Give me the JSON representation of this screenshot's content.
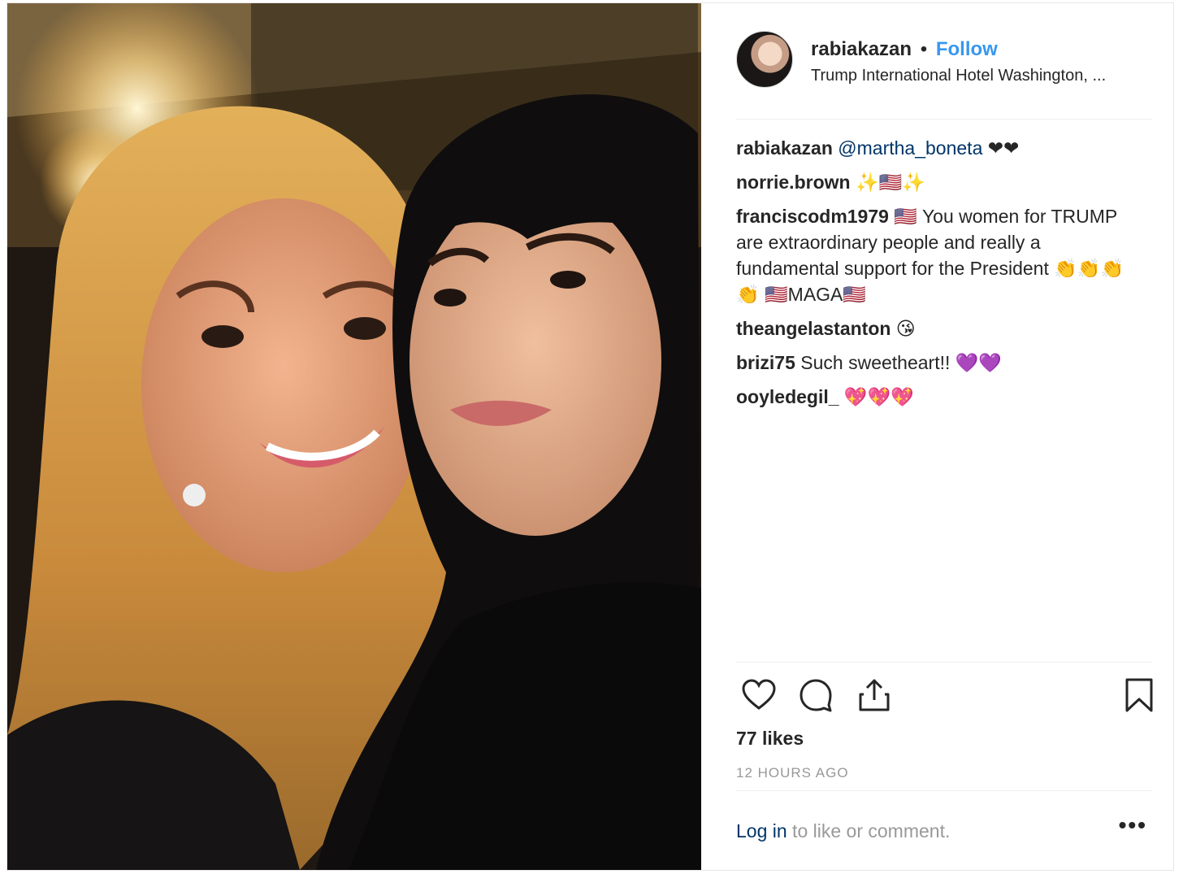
{
  "header": {
    "username": "rabiakazan",
    "separator": "•",
    "follow_label": "Follow",
    "location": "Trump International Hotel Washington, ..."
  },
  "comments": [
    {
      "user": "rabiakazan",
      "mention": "@martha_boneta",
      "text": " ❤❤"
    },
    {
      "user": "norrie.brown",
      "mention": "",
      "text": " ✨🇺🇸✨"
    },
    {
      "user": "franciscodm1979",
      "mention": "",
      "text": " 🇺🇸 You women for TRUMP are extraordinary people and really a fundamental support for the President 👏👏👏👏 🇺🇸MAGA🇺🇸"
    },
    {
      "user": "theangelastanton",
      "mention": "",
      "text": " 😘"
    },
    {
      "user": "brizi75",
      "mention": "",
      "text": " Such sweetheart!! 💜💜"
    },
    {
      "user": "ooyledegil_",
      "mention": "",
      "text": " 💖💖💖"
    }
  ],
  "actions": {
    "like_icon": "heart-icon",
    "comment_icon": "speech-bubble-icon",
    "share_icon": "share-icon",
    "save_icon": "bookmark-icon"
  },
  "likes": "77 likes",
  "timestamp": "12 HOURS AGO",
  "login": {
    "link": "Log in",
    "text": " to like or comment.",
    "more": "•••"
  },
  "colors": {
    "link": "#3897f0",
    "mention": "#003569",
    "muted": "#999999"
  }
}
